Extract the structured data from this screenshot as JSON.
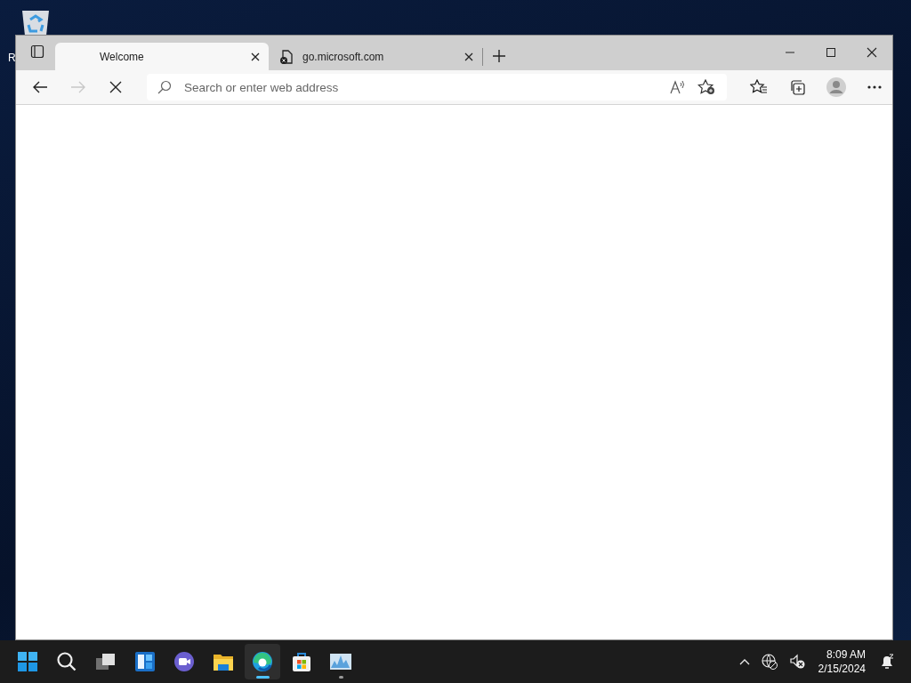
{
  "desktop": {
    "icons": [
      {
        "label": "R"
      }
    ]
  },
  "browser": {
    "tabs": [
      {
        "title": "Welcome",
        "selected": true,
        "kind": "blank"
      },
      {
        "title": "go.microsoft.com",
        "selected": false,
        "kind": "error"
      }
    ],
    "nav": {
      "forward_disabled": true,
      "loading": true
    },
    "address_bar": {
      "placeholder": "Search or enter web address"
    }
  },
  "taskbar": {
    "apps": [
      {
        "kind": "start",
        "selected": false,
        "running": false
      },
      {
        "kind": "search",
        "selected": false,
        "running": false
      },
      {
        "kind": "taskview",
        "selected": false,
        "running": false
      },
      {
        "kind": "widgets",
        "selected": false,
        "running": false
      },
      {
        "kind": "chat",
        "selected": false,
        "running": false
      },
      {
        "kind": "explorer",
        "selected": false,
        "running": false
      },
      {
        "kind": "edge",
        "selected": true,
        "running": true
      },
      {
        "kind": "store",
        "selected": false,
        "running": false
      },
      {
        "kind": "monitor",
        "selected": false,
        "running": true
      }
    ],
    "clock": {
      "time": "8:09 AM",
      "date": "2/15/2024"
    }
  }
}
